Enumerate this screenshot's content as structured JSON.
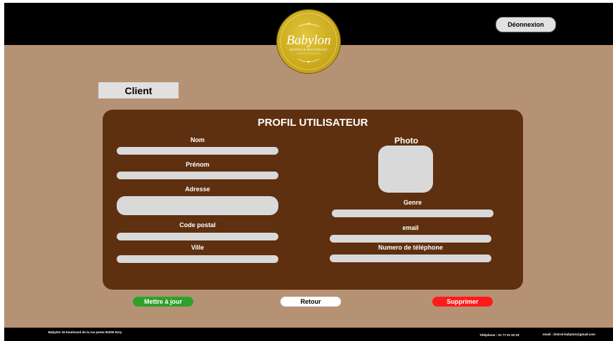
{
  "header": {
    "logout_label": "Déonnexion",
    "logo_title": "Babylon",
    "logo_subtitle": "BISTROT & RESTAURANT"
  },
  "section_tag": "Client",
  "profile": {
    "title": "PROFIL UTILISATEUR",
    "fields_left": [
      {
        "label": "Nom",
        "value": ""
      },
      {
        "label": "Prénom",
        "value": ""
      },
      {
        "label": "Adresse",
        "value": ""
      },
      {
        "label": "Code postal",
        "value": ""
      },
      {
        "label": "Ville",
        "value": ""
      }
    ],
    "photo_label": "Photo",
    "fields_right": [
      {
        "label": "Genre",
        "value": ""
      },
      {
        "label": "email",
        "value": ""
      },
      {
        "label": "Numero de téléphone",
        "value": ""
      }
    ]
  },
  "actions": {
    "update_label": "Mettre à jour",
    "back_label": "Retour",
    "delete_label": "Supprimer"
  },
  "footer": {
    "address": "Babylon 15 boulevard de la rue pentu 91000 Evry",
    "phone": "Téléphone : 01 77 01 02 03",
    "email": "email : bistrot-babylon@gmail.com"
  },
  "colors": {
    "background": "#b69275",
    "card": "#5e3010",
    "update_button": "#2ea12a",
    "delete_button": "#ff1a1a",
    "logo_gold": "#d4b42a"
  },
  "icons": [
    "logo-emblem"
  ]
}
